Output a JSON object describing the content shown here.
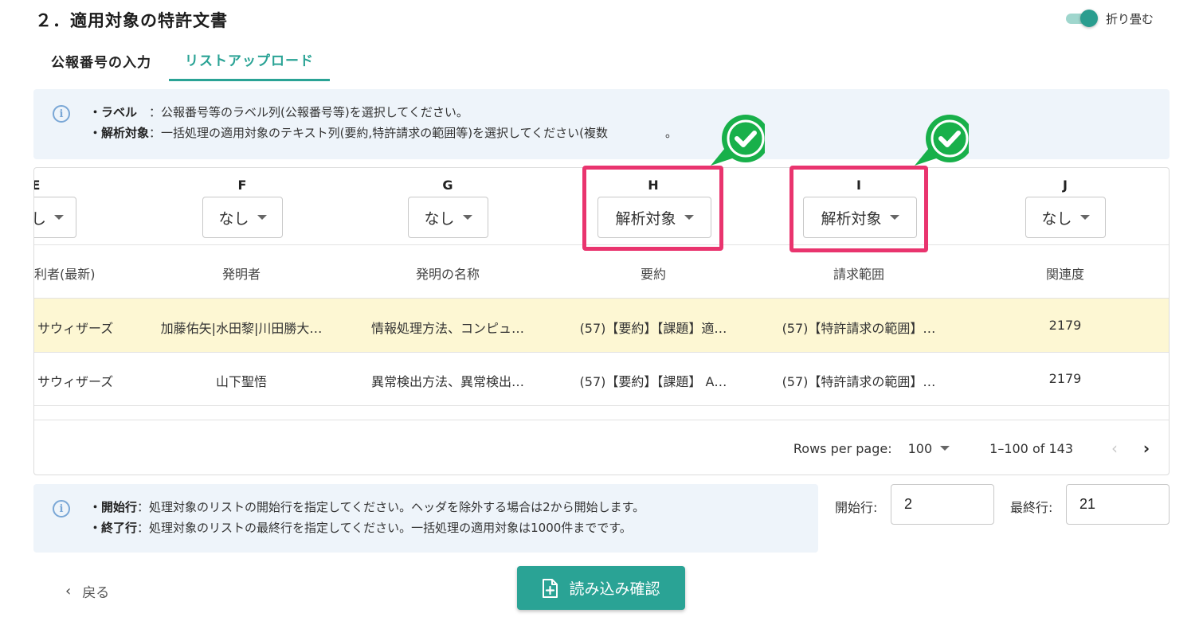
{
  "section_title": "２．適用対象の特許文書",
  "collapse_label": "折り畳む",
  "tabs": [
    {
      "label": "公報番号の入力"
    },
    {
      "label": "リストアップロード"
    }
  ],
  "info_top": {
    "line1_key": "・ラベル　",
    "line1_text": "：公報番号等のラベル列(公報番号等)を選択してください。",
    "line2_key": "・解析対象",
    "line2_text": "：一括処理の適用対象のテキスト列(要約,特許請求の範囲等)を選択してください(複数",
    "line2_tail": "。"
  },
  "table": {
    "columns": [
      {
        "letter": "E",
        "select": "し",
        "header": "利者(最新)"
      },
      {
        "letter": "F",
        "select": "なし",
        "header": "発明者"
      },
      {
        "letter": "G",
        "select": "なし",
        "header": "発明の名称"
      },
      {
        "letter": "H",
        "select": "解析対象",
        "header": "要約"
      },
      {
        "letter": "I",
        "select": "解析対象",
        "header": "請求範囲"
      },
      {
        "letter": "J",
        "select": "なし",
        "header": "関連度"
      }
    ],
    "rows": [
      {
        "cells": [
          "サウィザーズ",
          "加藤佑矢|水田黎|川田勝大…",
          "情報処理方法、コンピュ…",
          "(57)【要約】【課題】適…",
          "(57)【特許請求の範囲】…",
          "2179"
        ]
      },
      {
        "cells": [
          "サウィザーズ",
          "山下聖悟",
          "異常検出方法、異常検出…",
          "(57)【要約】【課題】 A…",
          "(57)【特許請求の範囲】…",
          "2179"
        ]
      }
    ]
  },
  "pagination": {
    "rows_per_page_label": "Rows per page:",
    "rows_per_page": "100",
    "range": "1–100 of 143",
    "prev_icon": "‹",
    "next_icon": "›"
  },
  "info_bottom": {
    "line1_key": "・開始行",
    "line1_text": "：処理対象のリストの開始行を指定してください。ヘッダを除外する場合は2から開始します。",
    "line2_key": "・終了行",
    "line2_text": "：処理対象のリストの最終行を指定してください。一括処理の適用対象は1000件までです。"
  },
  "start_row": {
    "label": "開始行:",
    "value": "2"
  },
  "end_row": {
    "label": "最終行:",
    "value": "21"
  },
  "back_label": "戻る",
  "confirm_label": "読み込み確認",
  "colors": {
    "accent": "#2aa395",
    "highlight": "#e9346e",
    "check_badge": "#18b04a",
    "row_highlight": "#fdf7d3"
  }
}
